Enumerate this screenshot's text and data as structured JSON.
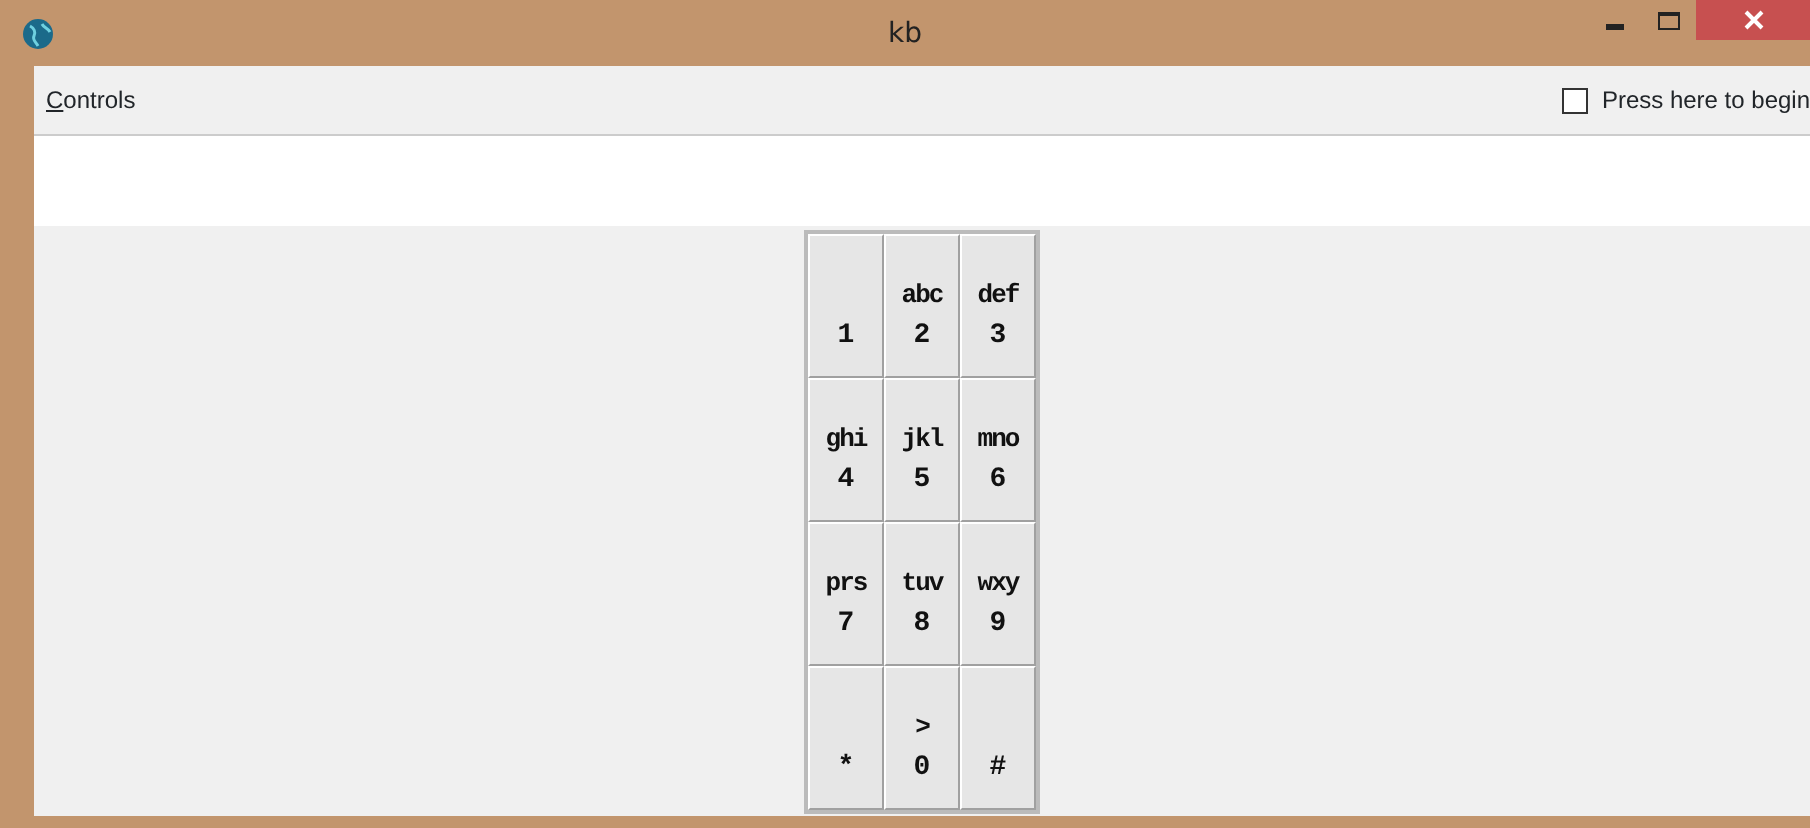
{
  "window": {
    "title": "kb"
  },
  "menu": {
    "label": "Controls"
  },
  "start_checkbox": {
    "label": "Press here to begin",
    "checked": false
  },
  "keys": [
    {
      "digit": "1"
    },
    {
      "letters": "abc",
      "digit": "2"
    },
    {
      "letters": "def",
      "digit": "3"
    },
    {
      "letters": "ghi",
      "digit": "4"
    },
    {
      "letters": "jkl",
      "digit": "5"
    },
    {
      "letters": "mno",
      "digit": "6"
    },
    {
      "letters": "prs",
      "digit": "7"
    },
    {
      "letters": "tuv",
      "digit": "8"
    },
    {
      "letters": "wxy",
      "digit": "9"
    },
    {
      "digit": "*"
    },
    {
      "letters": ">",
      "digit": "0"
    },
    {
      "digit": "#"
    }
  ]
}
